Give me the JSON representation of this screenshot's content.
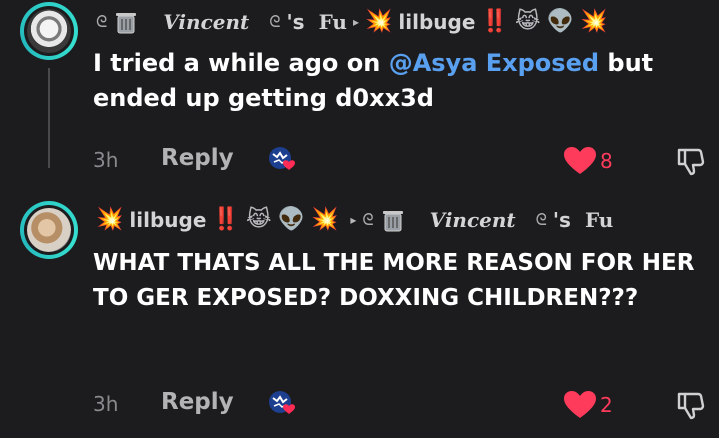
{
  "comments": [
    {
      "header": {
        "name_part1": "Vincent",
        "name_part2": "'s",
        "name_part3": "Fu",
        "arrow": "▸",
        "reply_to": "lilbuge",
        "exclaim": "‼️",
        "emoji_laugh": "😹",
        "emoji_alien": "👽",
        "emoji_boom": "💥"
      },
      "text_pre": "I tried a while ago on ",
      "mention": "@Asya Exposed",
      "text_post": " but ended up getting d0xx3d",
      "time": "3h",
      "reply_label": "Reply",
      "likes": "8"
    },
    {
      "header": {
        "name": "lilbuge",
        "exclaim": "‼️",
        "emoji_laugh": "😹",
        "emoji_alien": "👽",
        "emoji_boom": "💥",
        "arrow": "▸",
        "reply_to_part1": "Vincent",
        "reply_to_part2": "'s",
        "reply_to_part3": "Fu"
      },
      "text": "WHAT THATS ALL THE MORE REASON FOR HER TO GER EXPOSED? DOXXING CHILDREN???",
      "time": "3h",
      "reply_label": "Reply",
      "likes": "2"
    }
  ],
  "colors": {
    "background": "#1c1c1e",
    "mention": "#5aa0f0",
    "like": "#ff3b5c",
    "avatar_ring": "#2fd0c8"
  },
  "icons": [
    "trash-can-icon",
    "reply-sticker-icon",
    "heart-icon",
    "thumbs-down-icon",
    "caret-right-icon"
  ]
}
